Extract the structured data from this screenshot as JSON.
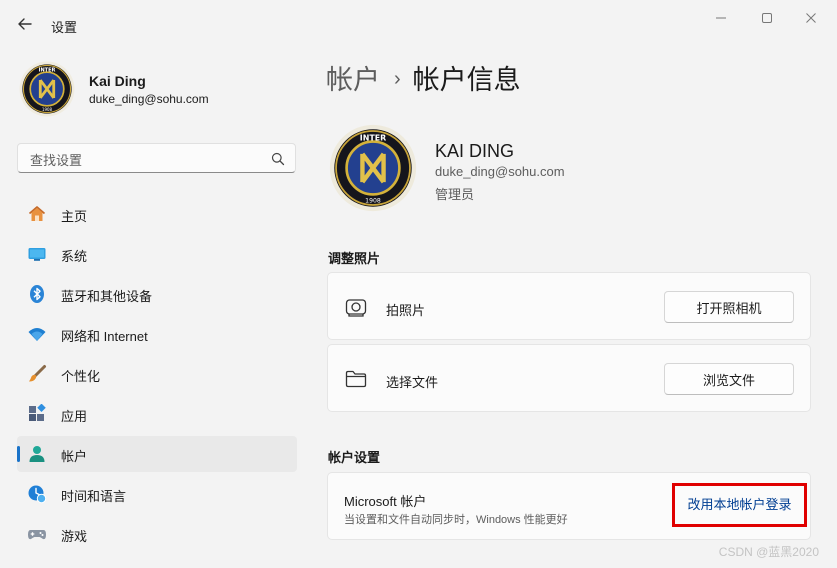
{
  "window": {
    "app_title": "设置",
    "back_icon": "arrow-left-icon",
    "minimize_icon": "minimize-icon",
    "maximize_icon": "maximize-icon",
    "close_icon": "close-icon"
  },
  "profile": {
    "name": "Kai Ding",
    "email": "duke_ding@sohu.com",
    "avatar_icon": "inter-club-logo-avatar"
  },
  "search": {
    "placeholder": "查找设置",
    "value": "",
    "icon": "search-icon"
  },
  "sidebar": {
    "items": [
      {
        "label": "主页",
        "icon": "home-icon",
        "selected": false
      },
      {
        "label": "系统",
        "icon": "system-display-icon",
        "selected": false
      },
      {
        "label": "蓝牙和其他设备",
        "icon": "bluetooth-icon",
        "selected": false
      },
      {
        "label": "网络和 Internet",
        "icon": "wifi-icon",
        "selected": false
      },
      {
        "label": "个性化",
        "icon": "paintbrush-icon",
        "selected": false
      },
      {
        "label": "应用",
        "icon": "apps-icon",
        "selected": false
      },
      {
        "label": "帐户",
        "icon": "account-icon",
        "selected": true
      },
      {
        "label": "时间和语言",
        "icon": "time-language-icon",
        "selected": false
      },
      {
        "label": "游戏",
        "icon": "gamepad-icon",
        "selected": false
      }
    ]
  },
  "breadcrumb": {
    "parent": "帐户",
    "separator": "›",
    "current": "帐户信息"
  },
  "account": {
    "display_name": "KAI DING",
    "email": "duke_ding@sohu.com",
    "role": "管理员"
  },
  "photo_section": {
    "title": "调整照片",
    "rows": [
      {
        "label": "拍照片",
        "icon": "camera-icon",
        "button": "打开照相机"
      },
      {
        "label": "选择文件",
        "icon": "folder-icon",
        "button": "浏览文件"
      }
    ]
  },
  "account_settings": {
    "title": "帐户设置",
    "microsoft_title": "Microsoft 帐户",
    "microsoft_desc": "当设置和文件自动同步时，Windows 性能更好",
    "link": "改用本地帐户登录",
    "highlight_color": "#e00000",
    "link_color": "#003e92"
  },
  "watermark": "CSDN @蓝黑2020",
  "colors": {
    "accent": "#1a73c9",
    "background": "#f3f3f3",
    "card": "#fbfbfb"
  }
}
